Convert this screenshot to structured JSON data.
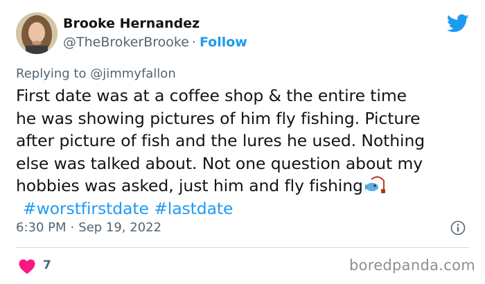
{
  "author": {
    "name": "Brooke Hernandez",
    "handle": "@TheBrokerBrooke",
    "separator": "·",
    "follow_label": "Follow"
  },
  "reply": {
    "prefix": "Replying to",
    "mention": "@jimmyfallon"
  },
  "tweet": {
    "lines": [
      "First date was at a coffee shop & the entire time",
      "he was showing pictures of him fly fishing. Picture",
      "after picture of fish and the lures he used. Nothing",
      "else was talked about. Not one question about my",
      "hobbies was asked, just him and fly fishing"
    ],
    "emoji_icon": "fishing-pole-icon",
    "hashtags": [
      "#worstfirstdate",
      "#lastdate"
    ]
  },
  "meta": {
    "time": "6:30 PM",
    "separator": "·",
    "date": "Sep 19, 2022"
  },
  "likes": {
    "count": "7",
    "icon": "heart-icon"
  },
  "watermark": "boredpanda.com",
  "colors": {
    "twitter_blue": "#1d9bf0",
    "heart_red": "#f91880",
    "text": "#0f1419",
    "secondary": "#536471"
  }
}
